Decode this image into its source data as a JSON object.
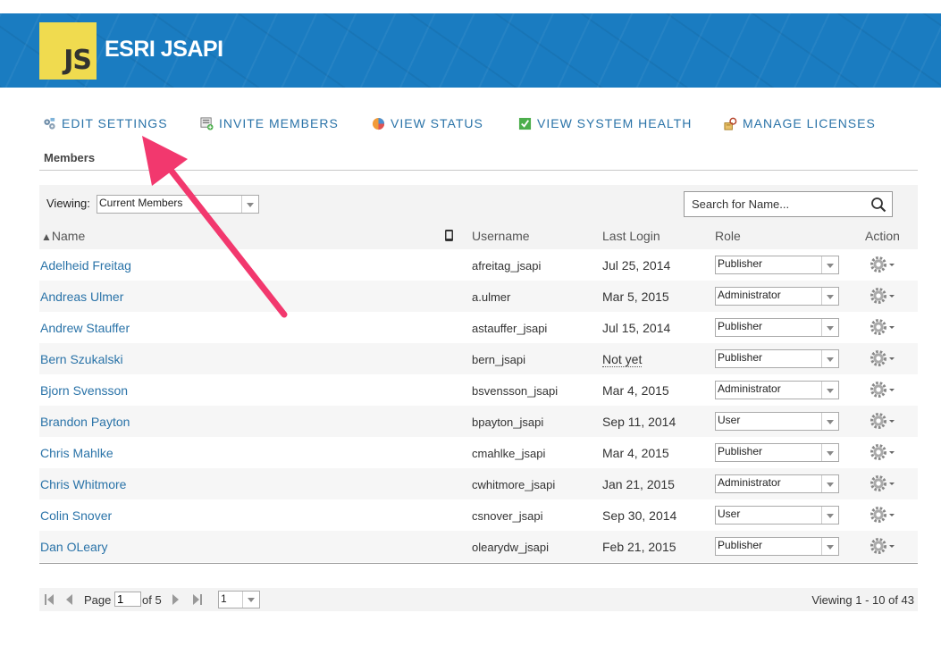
{
  "header": {
    "logo_text": "JS",
    "org_name": "ESRI JSAPI"
  },
  "nav": [
    {
      "label": "EDIT SETTINGS",
      "icon": "settings-icon"
    },
    {
      "label": "INVITE MEMBERS",
      "icon": "invite-icon"
    },
    {
      "label": "VIEW STATUS",
      "icon": "pie-chart-icon"
    },
    {
      "label": "VIEW SYSTEM HEALTH",
      "icon": "checkmark-icon"
    },
    {
      "label": "MANAGE LICENSES",
      "icon": "license-key-icon"
    }
  ],
  "section_title": "Members",
  "toolbar": {
    "viewing_label": "Viewing:",
    "viewing_value": "Current Members",
    "search_placeholder": "Search for Name..."
  },
  "table": {
    "headers": {
      "name": "Name",
      "username": "Username",
      "last_login": "Last Login",
      "role": "Role",
      "action": "Action"
    },
    "sort_indicator": "▲",
    "rows": [
      {
        "name": "Adelheid Freitag",
        "username": "afreitag_jsapi",
        "last_login": "Jul 25, 2014",
        "role": "Publisher"
      },
      {
        "name": "Andreas Ulmer",
        "username": "a.ulmer",
        "last_login": "Mar 5, 2015",
        "role": "Administrator"
      },
      {
        "name": "Andrew Stauffer",
        "username": "astauffer_jsapi",
        "last_login": "Jul 15, 2014",
        "role": "Publisher"
      },
      {
        "name": "Bern Szukalski",
        "username": "bern_jsapi",
        "last_login": "Not yet",
        "role": "Publisher"
      },
      {
        "name": "Bjorn Svensson",
        "username": "bsvensson_jsapi",
        "last_login": "Mar 4, 2015",
        "role": "Administrator"
      },
      {
        "name": "Brandon Payton",
        "username": "bpayton_jsapi",
        "last_login": "Sep 11, 2014",
        "role": "User"
      },
      {
        "name": "Chris Mahlke",
        "username": "cmahlke_jsapi",
        "last_login": "Mar 4, 2015",
        "role": "Publisher"
      },
      {
        "name": "Chris Whitmore",
        "username": "cwhitmore_jsapi",
        "last_login": "Jan 21, 2015",
        "role": "Administrator"
      },
      {
        "name": "Colin Snover",
        "username": "csnover_jsapi",
        "last_login": "Sep 30, 2014",
        "role": "User"
      },
      {
        "name": "Dan OLeary",
        "username": "olearydw_jsapi",
        "last_login": "Feb 21, 2015",
        "role": "Publisher"
      }
    ]
  },
  "pager": {
    "page_label": "Page",
    "page_value": "1",
    "of_label": "of 5",
    "page_size": "1",
    "viewing_text": "Viewing 1 - 10 of 43"
  },
  "colors": {
    "banner": "#1a7cc1",
    "link": "#2a73a8",
    "arrow": "#f2386e",
    "logo_bg": "#f0db4f"
  }
}
